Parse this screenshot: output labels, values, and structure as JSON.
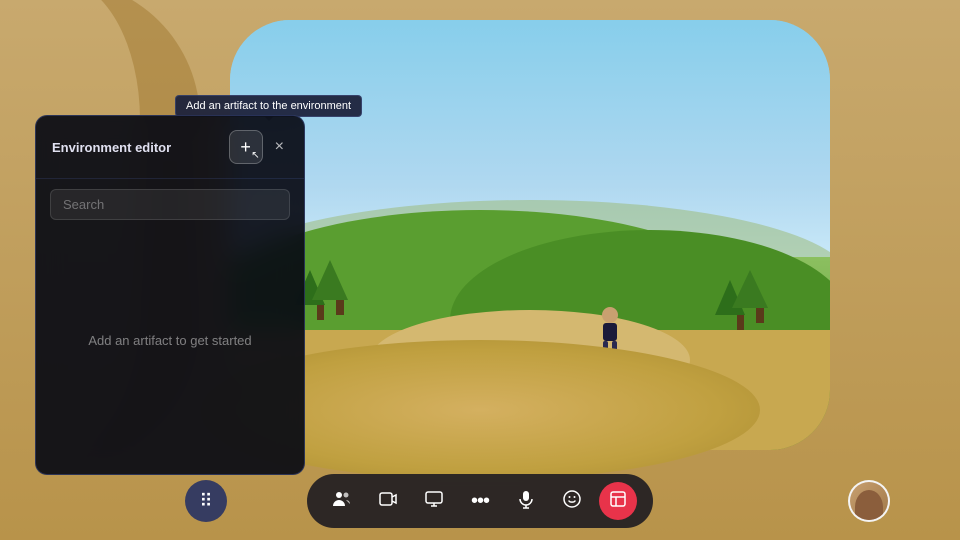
{
  "scene": {
    "background_color": "#c8a050"
  },
  "tooltip": {
    "text": "Add an artifact to the environment"
  },
  "env_panel": {
    "title": "Environment editor",
    "add_button_label": "+",
    "close_button_label": "×",
    "search_placeholder": "Search",
    "empty_message": "Add an artifact to get started"
  },
  "toolbar": {
    "buttons": [
      {
        "id": "people",
        "icon": "👥",
        "label": "People",
        "active": false
      },
      {
        "id": "media",
        "icon": "🎬",
        "label": "Media",
        "active": false
      },
      {
        "id": "screen",
        "icon": "🖥",
        "label": "Screen share",
        "active": false
      },
      {
        "id": "more",
        "icon": "···",
        "label": "More",
        "active": false
      },
      {
        "id": "mic",
        "icon": "🎤",
        "label": "Microphone",
        "active": false
      },
      {
        "id": "emoji",
        "icon": "🙂",
        "label": "Emoji",
        "active": false
      },
      {
        "id": "artifacts",
        "icon": "⬜",
        "label": "Artifacts",
        "active": true
      }
    ],
    "apps_button": "⠿",
    "avatar_label": "Avatar"
  }
}
